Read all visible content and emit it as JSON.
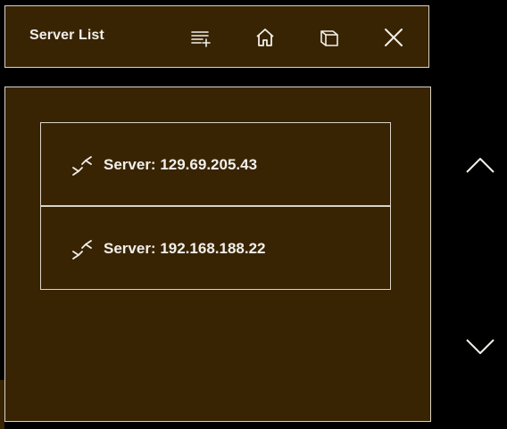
{
  "header": {
    "title": "Server List",
    "buttons": [
      {
        "name": "add-list-button",
        "icon": "playlist-add-icon"
      },
      {
        "name": "home-button",
        "icon": "home-icon"
      },
      {
        "name": "window-button",
        "icon": "window-stack-icon"
      },
      {
        "name": "close-button",
        "icon": "close-icon"
      }
    ]
  },
  "servers": [
    {
      "label": "Server: 129.69.205.43",
      "icon": "connect-arrows-icon"
    },
    {
      "label": "Server: 192.168.188.22",
      "icon": "connect-arrows-icon"
    }
  ],
  "scroll": {
    "up_icon": "chevron-up-icon",
    "down_icon": "chevron-down-icon"
  },
  "colors": {
    "background": "#000000",
    "panel": "#382403",
    "border": "#d9d3c8",
    "text": "#f2efe9"
  }
}
